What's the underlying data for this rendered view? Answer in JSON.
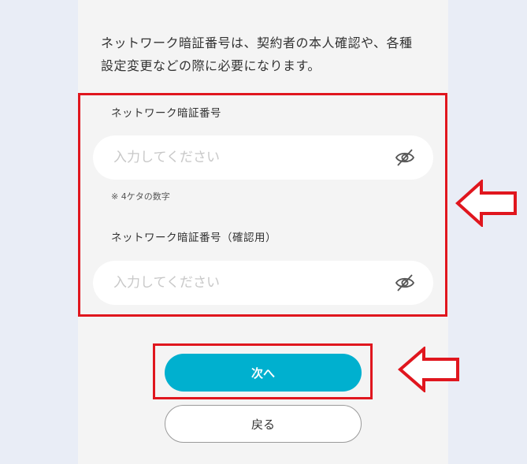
{
  "intro_text": "ネットワーク暗証番号は、契約者の本人確認や、各種設定変更などの際に必要になります。",
  "pin_field": {
    "label": "ネットワーク暗証番号",
    "placeholder": "入力してください",
    "icon": "eye-off-icon"
  },
  "pin_note": "※ 4ケタの数字",
  "confirm_field": {
    "label": "ネットワーク暗証番号（確認用）",
    "placeholder": "入力してください",
    "icon": "eye-off-icon"
  },
  "buttons": {
    "next_label": "次へ",
    "back_label": "戻る"
  },
  "colors": {
    "primary": "#00b0cf",
    "highlight": "#e0161e",
    "background": "#e9edf6",
    "card": "#f4f4f4"
  }
}
